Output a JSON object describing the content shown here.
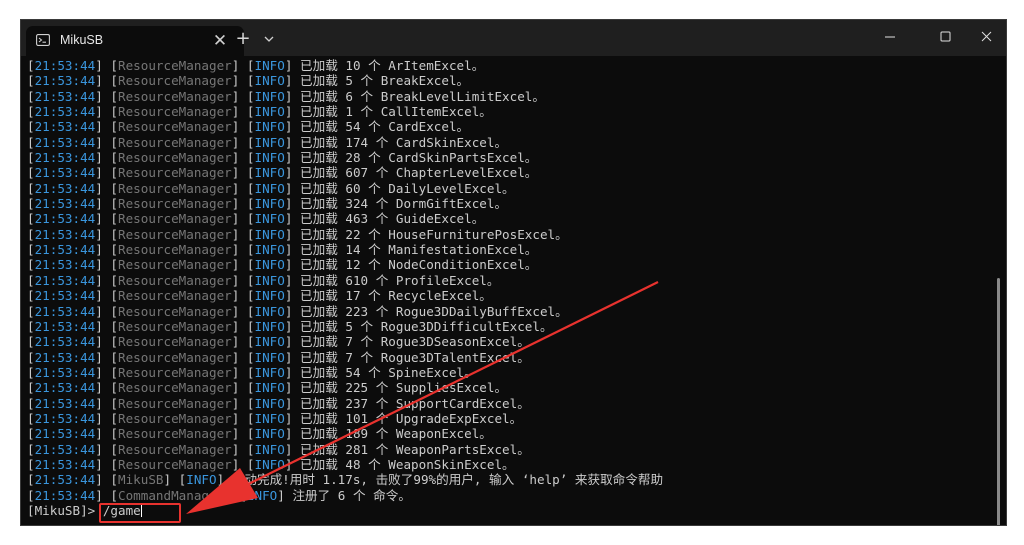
{
  "window": {
    "tab_title": "MikuSB",
    "tab_close": "✕",
    "new_tab": "+"
  },
  "log": [
    {
      "time": "21:53:44",
      "source": "ResourceManager",
      "level": "INFO",
      "message": "已加载 10 个 ArItemExcel。"
    },
    {
      "time": "21:53:44",
      "source": "ResourceManager",
      "level": "INFO",
      "message": "已加载 5 个 BreakExcel。"
    },
    {
      "time": "21:53:44",
      "source": "ResourceManager",
      "level": "INFO",
      "message": "已加载 6 个 BreakLevelLimitExcel。"
    },
    {
      "time": "21:53:44",
      "source": "ResourceManager",
      "level": "INFO",
      "message": "已加载 1 个 CallItemExcel。"
    },
    {
      "time": "21:53:44",
      "source": "ResourceManager",
      "level": "INFO",
      "message": "已加载 54 个 CardExcel。"
    },
    {
      "time": "21:53:44",
      "source": "ResourceManager",
      "level": "INFO",
      "message": "已加载 174 个 CardSkinExcel。"
    },
    {
      "time": "21:53:44",
      "source": "ResourceManager",
      "level": "INFO",
      "message": "已加载 28 个 CardSkinPartsExcel。"
    },
    {
      "time": "21:53:44",
      "source": "ResourceManager",
      "level": "INFO",
      "message": "已加载 607 个 ChapterLevelExcel。"
    },
    {
      "time": "21:53:44",
      "source": "ResourceManager",
      "level": "INFO",
      "message": "已加载 60 个 DailyLevelExcel。"
    },
    {
      "time": "21:53:44",
      "source": "ResourceManager",
      "level": "INFO",
      "message": "已加载 324 个 DormGiftExcel。"
    },
    {
      "time": "21:53:44",
      "source": "ResourceManager",
      "level": "INFO",
      "message": "已加载 463 个 GuideExcel。"
    },
    {
      "time": "21:53:44",
      "source": "ResourceManager",
      "level": "INFO",
      "message": "已加载 22 个 HouseFurniturePosExcel。"
    },
    {
      "time": "21:53:44",
      "source": "ResourceManager",
      "level": "INFO",
      "message": "已加载 14 个 ManifestationExcel。"
    },
    {
      "time": "21:53:44",
      "source": "ResourceManager",
      "level": "INFO",
      "message": "已加载 12 个 NodeConditionExcel。"
    },
    {
      "time": "21:53:44",
      "source": "ResourceManager",
      "level": "INFO",
      "message": "已加载 610 个 ProfileExcel。"
    },
    {
      "time": "21:53:44",
      "source": "ResourceManager",
      "level": "INFO",
      "message": "已加载 17 个 RecycleExcel。"
    },
    {
      "time": "21:53:44",
      "source": "ResourceManager",
      "level": "INFO",
      "message": "已加载 223 个 Rogue3DDailyBuffExcel。"
    },
    {
      "time": "21:53:44",
      "source": "ResourceManager",
      "level": "INFO",
      "message": "已加载 5 个 Rogue3DDifficultExcel。"
    },
    {
      "time": "21:53:44",
      "source": "ResourceManager",
      "level": "INFO",
      "message": "已加载 7 个 Rogue3DSeasonExcel。"
    },
    {
      "time": "21:53:44",
      "source": "ResourceManager",
      "level": "INFO",
      "message": "已加载 7 个 Rogue3DTalentExcel。"
    },
    {
      "time": "21:53:44",
      "source": "ResourceManager",
      "level": "INFO",
      "message": "已加载 54 个 SpineExcel。"
    },
    {
      "time": "21:53:44",
      "source": "ResourceManager",
      "level": "INFO",
      "message": "已加载 225 个 SuppliesExcel。"
    },
    {
      "time": "21:53:44",
      "source": "ResourceManager",
      "level": "INFO",
      "message": "已加载 237 个 SupportCardExcel。"
    },
    {
      "time": "21:53:44",
      "source": "ResourceManager",
      "level": "INFO",
      "message": "已加载 101 个 UpgradeExpExcel。"
    },
    {
      "time": "21:53:44",
      "source": "ResourceManager",
      "level": "INFO",
      "message": "已加载 189 个 WeaponExcel。"
    },
    {
      "time": "21:53:44",
      "source": "ResourceManager",
      "level": "INFO",
      "message": "已加载 281 个 WeaponPartsExcel。"
    },
    {
      "time": "21:53:44",
      "source": "ResourceManager",
      "level": "INFO",
      "message": "已加载 48 个 WeaponSkinExcel。"
    },
    {
      "time": "21:53:44",
      "source": "MikuSB",
      "level": "INFO",
      "message": "启动完成!用时 1.17s, 击败了99%的用户, 输入 ‘help’ 来获取命令帮助"
    },
    {
      "time": "21:53:44",
      "source": "CommandManager",
      "level": "INFO",
      "message": "注册了 6 个 命令。"
    }
  ],
  "prompt": {
    "label": "[MikuSB]>",
    "input_value": "/game"
  },
  "annotation": {
    "color": "#e8322e"
  }
}
